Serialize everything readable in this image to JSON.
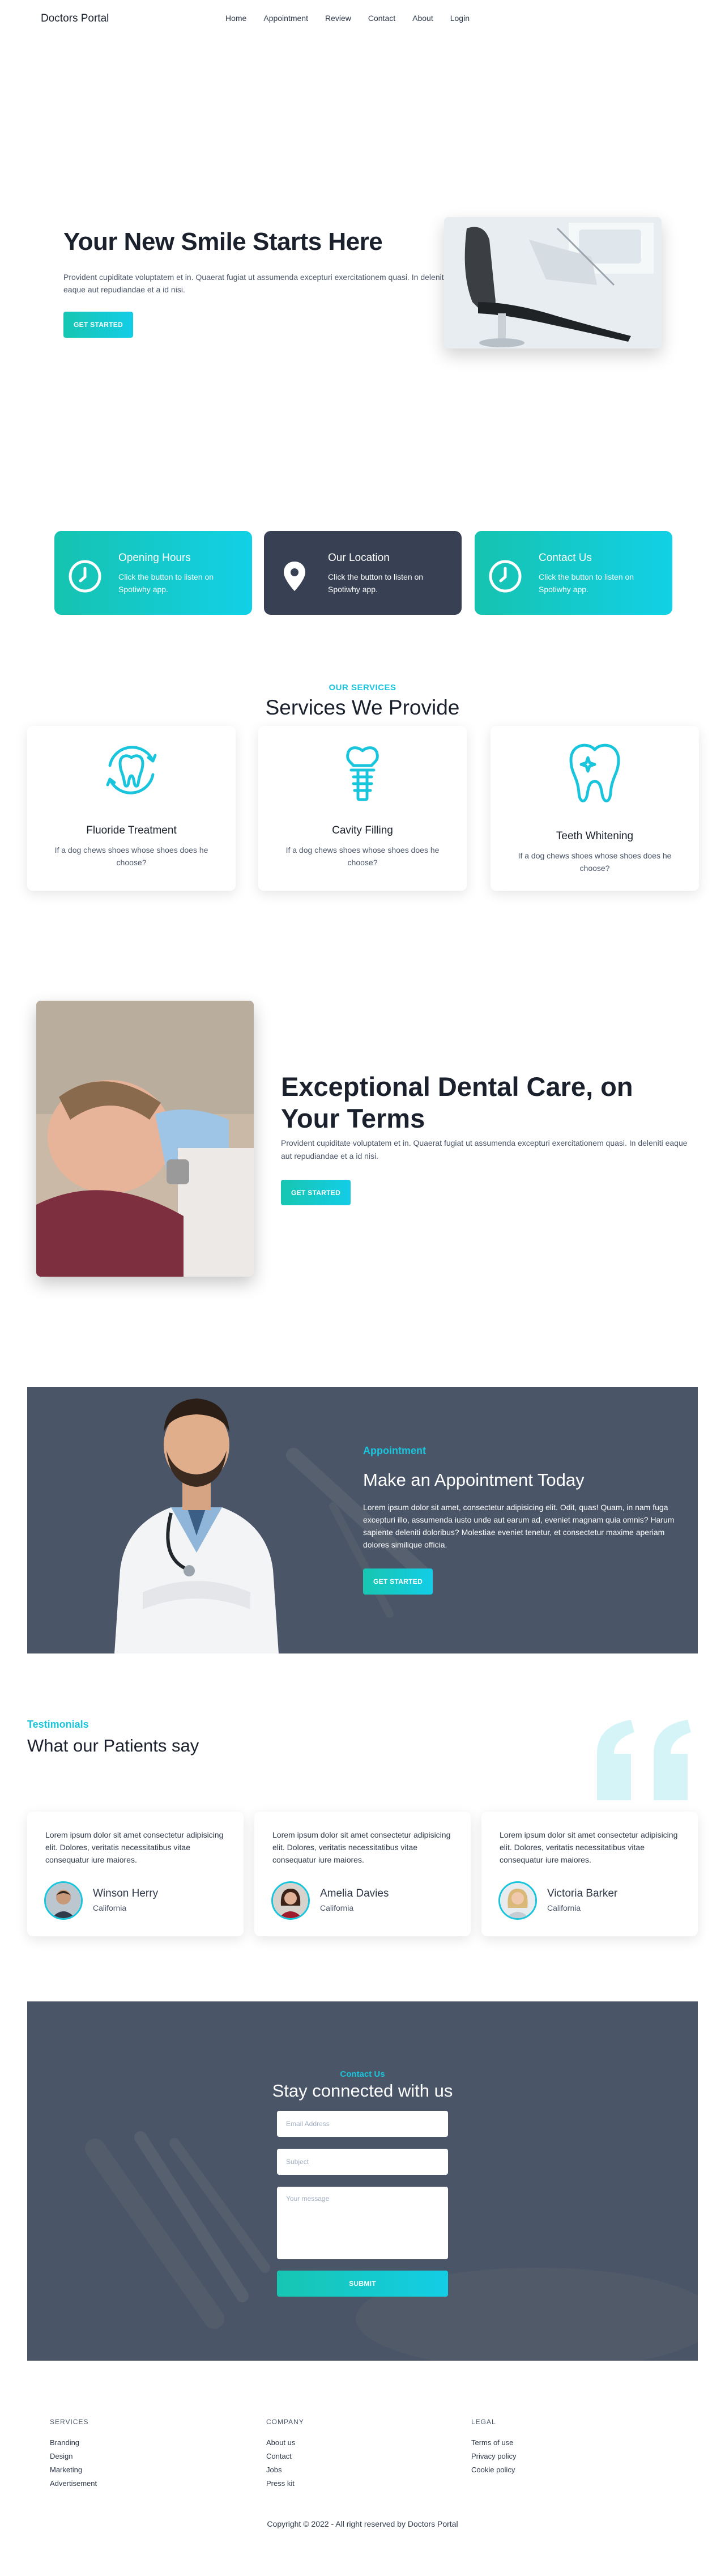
{
  "nav": {
    "brand": "Doctors Portal",
    "links": [
      "Home",
      "Appointment",
      "Review",
      "Contact",
      "About",
      "Login"
    ]
  },
  "hero": {
    "title": "Your New Smile Starts Here",
    "text": "Provident cupiditate voluptatem et in. Quaerat fugiat ut assumenda excepturi exercitationem quasi. In deleniti eaque aut repudiandae et a id nisi.",
    "button": "GET STARTED"
  },
  "info_cards": [
    {
      "title": "Opening Hours",
      "text": "Click the button to listen on Spotiwhy app.",
      "icon": "clock-icon"
    },
    {
      "title": "Our Location",
      "text": "Click the button to listen on Spotiwhy app.",
      "icon": "location-pin-icon"
    },
    {
      "title": "Contact Us",
      "text": "Click the button to listen on Spotiwhy app.",
      "icon": "clock-icon"
    }
  ],
  "services": {
    "kicker": "OUR SERVICES",
    "title": "Services We Provide",
    "items": [
      {
        "title": "Fluoride Treatment",
        "text": "If a dog chews shoes whose shoes does he choose?",
        "icon": "tooth-cycle-icon"
      },
      {
        "title": "Cavity Filling",
        "text": "If a dog chews shoes whose shoes does he choose?",
        "icon": "dental-implant-icon"
      },
      {
        "title": "Teeth Whitening",
        "text": "If a dog chews shoes whose shoes does he choose?",
        "icon": "sparkling-tooth-icon"
      }
    ]
  },
  "dental_care": {
    "title": "Exceptional Dental Care, on Your Terms",
    "text": "Provident cupiditate voluptatem et in. Quaerat fugiat ut assumenda excepturi exercitationem quasi. In deleniti eaque aut repudiandae et a id nisi.",
    "button": "GET STARTED"
  },
  "appointment": {
    "kicker": "Appointment",
    "title": "Make an Appointment Today",
    "text": "Lorem ipsum dolor sit amet, consectetur adipisicing elit. Odit, quas! Quam, in nam fuga excepturi illo, assumenda iusto unde aut earum ad, eveniet magnam quia omnis? Harum sapiente deleniti doloribus? Molestiae eveniet tenetur, et consectetur maxime aperiam dolores similique officia.",
    "button": "GET STARTED"
  },
  "testimonials": {
    "kicker": "Testimonials",
    "title": "What our Patients say",
    "items": [
      {
        "quote": "Lorem ipsum dolor sit amet consectetur adipisicing elit. Dolores, veritatis necessitatibus vitae consequatur iure maiores.",
        "name": "Winson Herry",
        "location": "California"
      },
      {
        "quote": "Lorem ipsum dolor sit amet consectetur adipisicing elit. Dolores, veritatis necessitatibus vitae consequatur iure maiores.",
        "name": "Amelia Davies",
        "location": "California"
      },
      {
        "quote": "Lorem ipsum dolor sit amet consectetur adipisicing elit. Dolores, veritatis necessitatibus vitae consequatur iure maiores.",
        "name": "Victoria Barker",
        "location": "California"
      }
    ]
  },
  "contact": {
    "kicker": "Contact Us",
    "title": "Stay connected with us",
    "email_placeholder": "Email Address",
    "subject_placeholder": "Subject",
    "message_placeholder": "Your message",
    "button": "SUBMIT"
  },
  "footer": {
    "services": {
      "heading": "SERVICES",
      "links": [
        "Branding",
        "Design",
        "Marketing",
        "Advertisement"
      ]
    },
    "company": {
      "heading": "COMPANY",
      "links": [
        "About us",
        "Contact",
        "Jobs",
        "Press kit"
      ]
    },
    "legal": {
      "heading": "LEGAL",
      "links": [
        "Terms of use",
        "Privacy policy",
        "Cookie policy"
      ]
    },
    "copyright": "Copyright © 2022 - All right reserved by Doctors Portal"
  },
  "colors": {
    "accent": "#19c5dd",
    "teal": "#16c3b0",
    "dark_card": "#384153",
    "section_bg": "#4a5568"
  }
}
